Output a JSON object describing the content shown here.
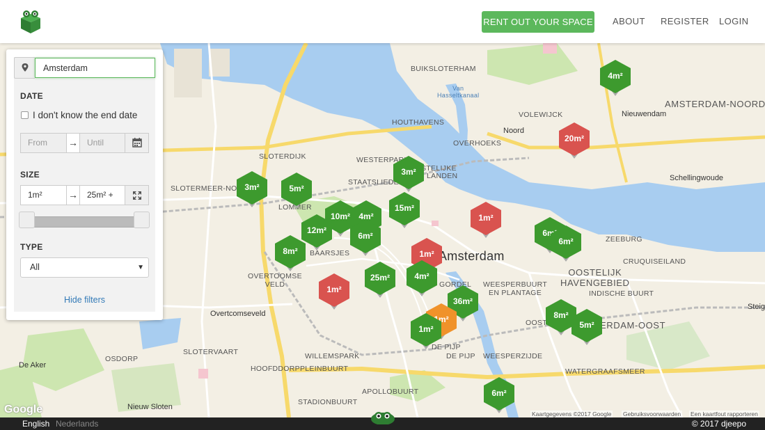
{
  "header": {
    "rent_label": "RENT OUT YOUR SPACE",
    "nav": {
      "about": "ABOUT",
      "register": "REGISTER",
      "login": "LOGIN"
    },
    "accent": "#5cb85c"
  },
  "filters": {
    "location_value": "Amsterdam",
    "date": {
      "title": "DATE",
      "unknown_end_label": "I don't know the end date",
      "unknown_end_checked": false,
      "from_placeholder": "From",
      "until_placeholder": "Until",
      "arrow": "→"
    },
    "size": {
      "title": "SIZE",
      "min": "1m²",
      "max": "25m² +",
      "arrow": "→"
    },
    "type": {
      "title": "TYPE",
      "selected": "All"
    },
    "hide_label": "Hide filters"
  },
  "map": {
    "places": {
      "buiksloterham": "BUIKSLOTERHAM",
      "amsterdam_noord": "AMSTERDAM-NOORD",
      "van_hasseltkanaal": "Van\nHasseltkanaal",
      "volewijck": "VOLEWIJCK",
      "nieuwendam": "Nieuwendam",
      "houthavens": "HOUTHAVENS",
      "noord": "Noord",
      "overhoeks": "OVERHOEKS",
      "sloterdijk": "SLOTERDIJK",
      "westerpark": "WESTERPARK",
      "stelijke": "STELIJKE",
      "landen": "LANDEN",
      "slotermeer_noord": "SLOTERMEER-NOORD",
      "staatsliedenbu": "STAATSLIEDENBU",
      "lommer": "LOMMER",
      "schellingwoude": "Schellingwoude",
      "zeeburg": "ZEEBURG",
      "baarsjes": "BAARSJES",
      "amsterdam": "Amsterdam",
      "cruquiseiland": "CRUQUISEILAND",
      "oostelijk_havengebied": "OOSTELIJK\nHAVENGEBIED",
      "overtoomse_veld": "OVERTOOMSE\nVELD",
      "grachtengordel": "GORDEL",
      "weesperbuurt": "WEESPERBUURT\nEN PLANTAGE",
      "indische_buurt": "INDISCHE BUURT",
      "overtcomseveld": "Overtcomseveld",
      "oosterpark": "OOSTERPARK",
      "amsterdam_oost": "ERDAM-OOST",
      "steig": "Steig",
      "de_aker": "De Aker",
      "osdorp": "OSDORP",
      "slotervaart": "SLOTERVAART",
      "willemspark": "WILLEMSPARK",
      "de_pijp": "DE PIJP",
      "weesperzijde": "WEESPERZIJDE",
      "de_pijp2": "DE PIJP",
      "hoofddorppleinbuurt": "HOOFDDORPPLEINBUURT",
      "watergraafsmeer": "WATERGRAAFSMEER",
      "apollobuurt": "APOLLOBUURT",
      "stadionbuurt": "STADIONBUURT",
      "nieuw_sloten": "Nieuw Sloten"
    },
    "markers": [
      {
        "label": "4m²",
        "status": "available"
      },
      {
        "label": "20m²",
        "status": "booked"
      },
      {
        "label": "3m²",
        "status": "available"
      },
      {
        "label": "3m²",
        "status": "available"
      },
      {
        "label": "5m²",
        "status": "available"
      },
      {
        "label": "15m²",
        "status": "available"
      },
      {
        "label": "10m²",
        "status": "available"
      },
      {
        "label": "4m²",
        "status": "available"
      },
      {
        "label": "12m²",
        "status": "available"
      },
      {
        "label": "6m²",
        "status": "available"
      },
      {
        "label": "1m²",
        "status": "booked"
      },
      {
        "label": "6m²",
        "status": "available"
      },
      {
        "label": "6m²",
        "status": "available"
      },
      {
        "label": "8m²",
        "status": "available"
      },
      {
        "label": "1m²",
        "status": "booked"
      },
      {
        "label": "25m²",
        "status": "available"
      },
      {
        "label": "4m²",
        "status": "available"
      },
      {
        "label": "1m²",
        "status": "booked"
      },
      {
        "label": "36m²",
        "status": "available"
      },
      {
        "label": "1m²",
        "status": "pending"
      },
      {
        "label": "1m²",
        "status": "available"
      },
      {
        "label": "8m²",
        "status": "available"
      },
      {
        "label": "5m²",
        "status": "available"
      },
      {
        "label": "6m²",
        "status": "available"
      }
    ],
    "colors": {
      "available": "#3d9a2e",
      "booked": "#d9534f",
      "pending": "#f0922a"
    },
    "attribution": {
      "data": "Kaartgegevens ©2017 Google",
      "terms": "Gebruiksvoorwaarden",
      "report": "Een kaartfout rapporteren"
    },
    "google": "Google"
  },
  "footer": {
    "lang_en": "English",
    "lang_nl": "Nederlands",
    "copyright": "© 2017 djeepo"
  }
}
